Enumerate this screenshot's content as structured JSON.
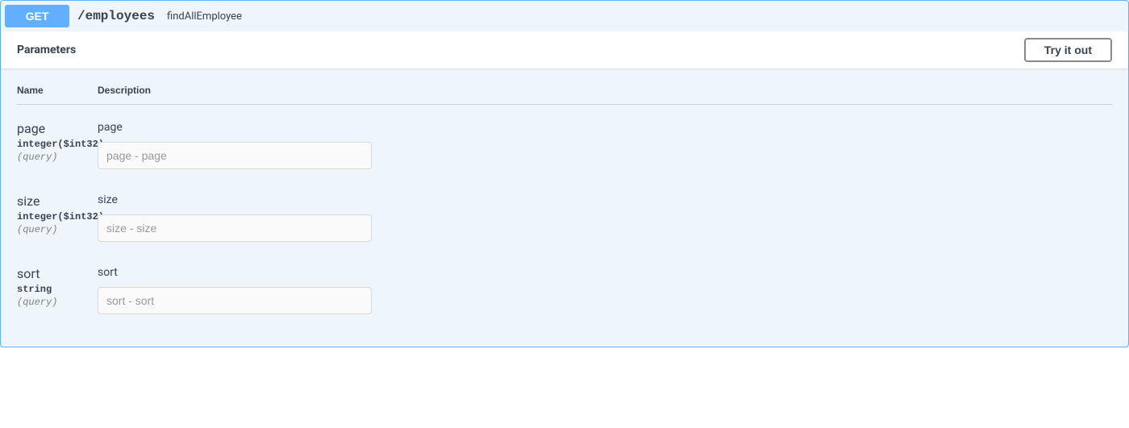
{
  "summary": {
    "method": "GET",
    "path": "/employees",
    "description": "findAllEmployee"
  },
  "parameters_section": {
    "title": "Parameters",
    "try_button": "Try it out",
    "columns": {
      "name": "Name",
      "description": "Description"
    }
  },
  "parameters": [
    {
      "name": "page",
      "type": "integer($int32)",
      "in": "(query)",
      "description": "page",
      "placeholder": "page - page"
    },
    {
      "name": "size",
      "type": "integer($int32)",
      "in": "(query)",
      "description": "size",
      "placeholder": "size - size"
    },
    {
      "name": "sort",
      "type": "string",
      "in": "(query)",
      "description": "sort",
      "placeholder": "sort - sort"
    }
  ]
}
